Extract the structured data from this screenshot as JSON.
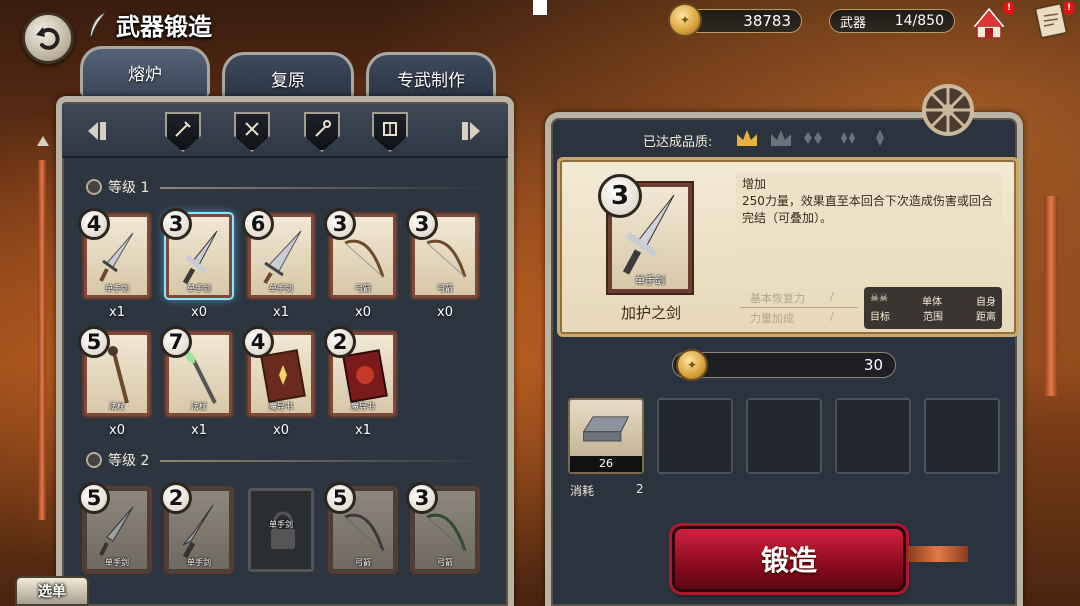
{
  "header": {
    "title": "武器锻造",
    "gold": "38783",
    "weapon_label": "武器",
    "weapon_count": "14/850",
    "alert_1": "!",
    "alert_2": "!"
  },
  "tabs": [
    {
      "label": "熔炉",
      "active": true
    },
    {
      "label": "复原",
      "active": false
    },
    {
      "label": "专武制作",
      "active": false
    }
  ],
  "filters": [
    "sword-icon",
    "axe-icon",
    "staff-icon",
    "bow-icon",
    "book-icon"
  ],
  "levels": [
    {
      "label": "等级 1",
      "items": [
        {
          "grade": "4",
          "type": "单手剑",
          "count": "x1"
        },
        {
          "grade": "3",
          "type": "单手剑",
          "count": "x0"
        },
        {
          "grade": "6",
          "type": "单手剑",
          "count": "x1"
        },
        {
          "grade": "3",
          "type": "弓箭",
          "count": "x0"
        },
        {
          "grade": "3",
          "type": "弓箭",
          "count": "x0"
        },
        {
          "grade": "5",
          "type": "法杖",
          "count": "x0"
        },
        {
          "grade": "7",
          "type": "法杖",
          "count": "x1"
        },
        {
          "grade": "4",
          "type": "魔导书",
          "count": "x0"
        },
        {
          "grade": "2",
          "type": "魔导书",
          "count": "x1"
        }
      ]
    },
    {
      "label": "等级 2",
      "items": [
        {
          "grade": "5",
          "type": "单手剑"
        },
        {
          "grade": "2",
          "type": "单手剑"
        },
        {
          "grade": "",
          "type": "单手剑"
        },
        {
          "grade": "5",
          "type": "弓箭"
        },
        {
          "grade": "3",
          "type": "弓箭"
        }
      ]
    }
  ],
  "select_button": "选单",
  "detail": {
    "quality_label": "已达成品质:",
    "grade": "3",
    "type": "单手剑",
    "name": "加护之剑",
    "desc_title": "增加",
    "desc_body": "250力量，效果直至本回合下次造成伤害或回合完结（可叠加）。",
    "stat_1": "基本恢复力",
    "stat_2": "力量加成",
    "stat_sep": "/",
    "target_value": "单体",
    "range_value": "自身",
    "target_label": "目标",
    "scope_label": "范围",
    "distance_label": "距离"
  },
  "cost": "30",
  "materials": {
    "first_qty": "26",
    "consume_label": "消耗",
    "consume_value": "2"
  },
  "forge_button": "锻造",
  "colors": {
    "forge_red": "#b11830",
    "frame": "#b9b3a4",
    "panel": "#2d3541",
    "gold": "#d7a03b"
  }
}
